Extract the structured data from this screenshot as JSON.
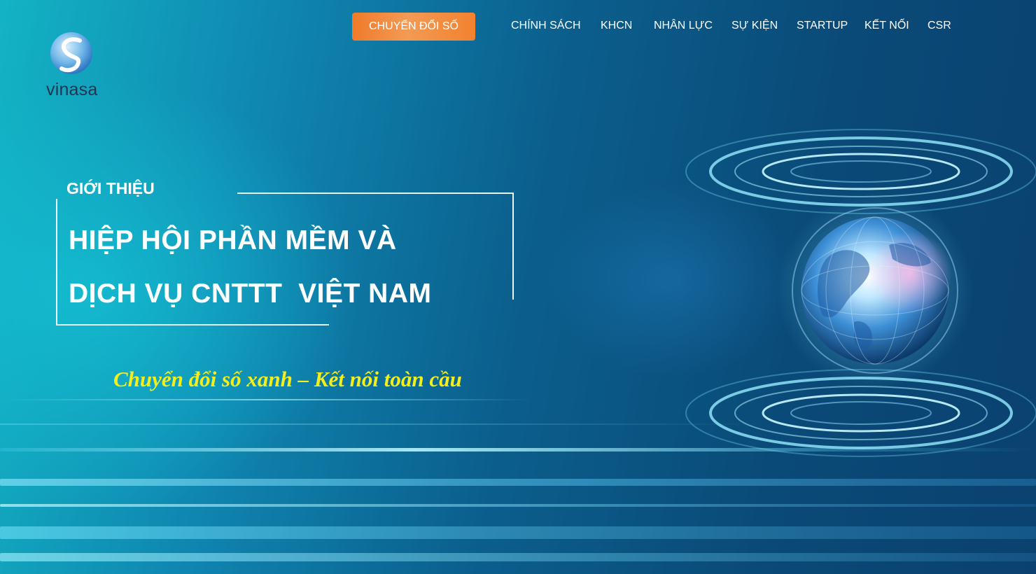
{
  "brand": {
    "name": "vinasa"
  },
  "nav": {
    "cta_label": "CHUYỂN ĐỔI SỐ",
    "items": [
      {
        "label": "CHÍNH SÁCH"
      },
      {
        "label": "KHCN"
      },
      {
        "label": "NHÂN LỰC"
      },
      {
        "label": "SỰ KIỆN"
      },
      {
        "label": "STARTUP"
      },
      {
        "label": "KẾT NỐI"
      },
      {
        "label": "CSR"
      }
    ]
  },
  "hero": {
    "intro_label": "GIỚI THIỆU",
    "title_line_1": "HIỆP HỘI PHẦN MỀM VÀ",
    "title_line_2": "DỊCH VỤ CNTTT  VIỆT NAM",
    "slogan": "Chuyển đổi số xanh – Kết nối toàn cầu"
  },
  "colors": {
    "cta": "#f07a2a",
    "slogan": "#f4ee1a",
    "text": "#ffffff",
    "background_dark": "#0a4170",
    "background_light": "#13b3c4"
  }
}
